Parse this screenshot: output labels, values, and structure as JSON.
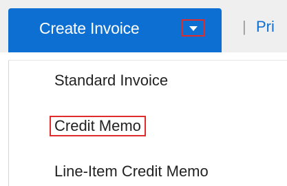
{
  "toolbar": {
    "create_invoice_label": "Create Invoice",
    "caret_icon": "caret-down-icon",
    "separator": "|",
    "print_label": "Pri"
  },
  "dropdown": {
    "items": [
      {
        "label": "Standard Invoice",
        "highlighted": false
      },
      {
        "label": "Credit Memo",
        "highlighted": true
      },
      {
        "label": "Line-Item Credit Memo",
        "highlighted": false
      }
    ]
  },
  "colors": {
    "primary": "#0d6fd2",
    "highlight_outline": "#e12a2a"
  }
}
